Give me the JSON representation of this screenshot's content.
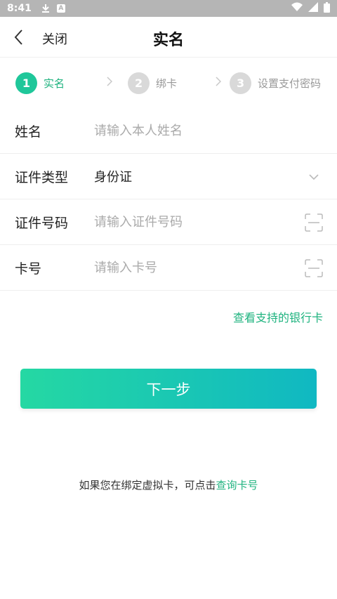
{
  "status_bar": {
    "time": "8:41",
    "icons": [
      "download-icon",
      "a-icon",
      "wifi-icon",
      "signal-icon",
      "battery-icon"
    ]
  },
  "nav": {
    "close_label": "关闭",
    "title": "实名"
  },
  "steps": [
    {
      "number": "1",
      "label": "实名",
      "state": "active"
    },
    {
      "number": "2",
      "label": "绑卡",
      "state": "inactive"
    },
    {
      "number": "3",
      "label": "设置支付密码",
      "state": "inactive"
    }
  ],
  "form": {
    "name": {
      "label": "姓名",
      "placeholder": "请输入本人姓名"
    },
    "id_type": {
      "label": "证件类型",
      "value": "身份证"
    },
    "id_number": {
      "label": "证件号码",
      "placeholder": "请输入证件号码"
    },
    "card_number": {
      "label": "卡号",
      "placeholder": "请输入卡号"
    }
  },
  "support_link": "查看支持的银行卡",
  "next_button": "下一步",
  "footer": {
    "text": "如果您在绑定虚拟卡，可点击",
    "link": "查询卡号"
  },
  "colors": {
    "accent": "#1fb37f",
    "step_active": "#1fc79a",
    "step_inactive": "#d9d9d9",
    "button_start": "#25d8a3",
    "button_end": "#10b8c2"
  }
}
